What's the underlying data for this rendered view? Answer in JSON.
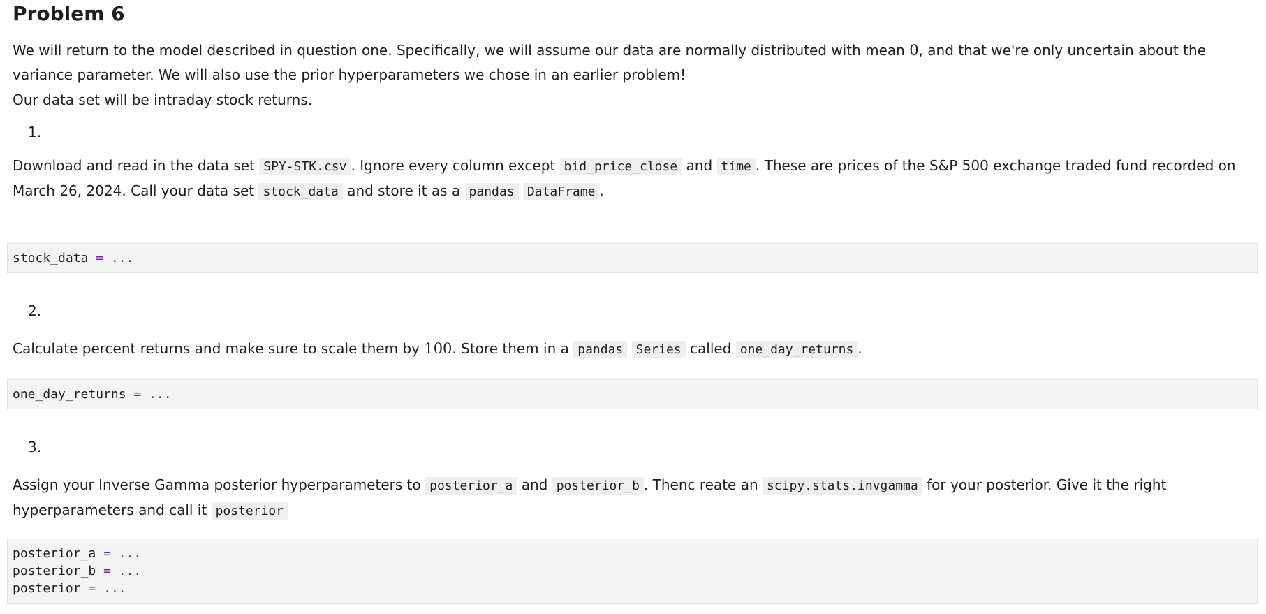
{
  "title": "Problem 6",
  "intro": {
    "p1_before": "We will return to the model described in question one. Specifically, we will assume our data are normally distributed with mean ",
    "p1_math": "0",
    "p1_after": ", and that we're only uncertain about the variance parameter. We will also use the prior hyperparameters we chose in an earlier problem!",
    "p2": "Our data set will be intraday stock returns."
  },
  "q1": {
    "number": "1.",
    "t1": "Download and read in the data set ",
    "c1": "SPY-STK.csv",
    "t2": ". Ignore every column except ",
    "c2": "bid_price_close",
    "t3": " and ",
    "c3": "time",
    "t4": ". These are prices of the S&P 500 exchange traded fund recorded on March 26, 2024. Call your data set ",
    "c4": "stock_data",
    "t5": " and store it as a ",
    "c5": "pandas",
    "c6": "DataFrame",
    "t6": ".",
    "code": {
      "var": "stock_data",
      "op": "=",
      "val": "..."
    }
  },
  "q2": {
    "number": "2.",
    "t1": "Calculate percent returns and make sure to scale them by ",
    "math": "100",
    "t2": ". Store them in a ",
    "c1": "pandas",
    "c2": "Series",
    "t3": " called ",
    "c3": "one_day_returns",
    "t4": ".",
    "code": {
      "var": "one_day_returns",
      "op": "=",
      "val": "..."
    }
  },
  "q3": {
    "number": "3.",
    "t1": "Assign your Inverse Gamma posterior hyperparameters to ",
    "c1": "posterior_a",
    "t2": " and ",
    "c2": "posterior_b",
    "t3": ". Thenc reate an ",
    "c3": "scipy.stats.invgamma",
    "t4": " for your posterior. Give it the right hyperparameters and call it ",
    "c4": "posterior",
    "code": [
      {
        "var": "posterior_a",
        "op": "=",
        "val": "..."
      },
      {
        "var": "posterior_b",
        "op": "=",
        "val": "..."
      },
      {
        "var": "posterior",
        "op": "=",
        "val": "..."
      }
    ]
  },
  "colors": {
    "operator": "#7a1fb5",
    "cell_bg": "#f4f4f4",
    "inline_code_bg": "#efefef"
  }
}
